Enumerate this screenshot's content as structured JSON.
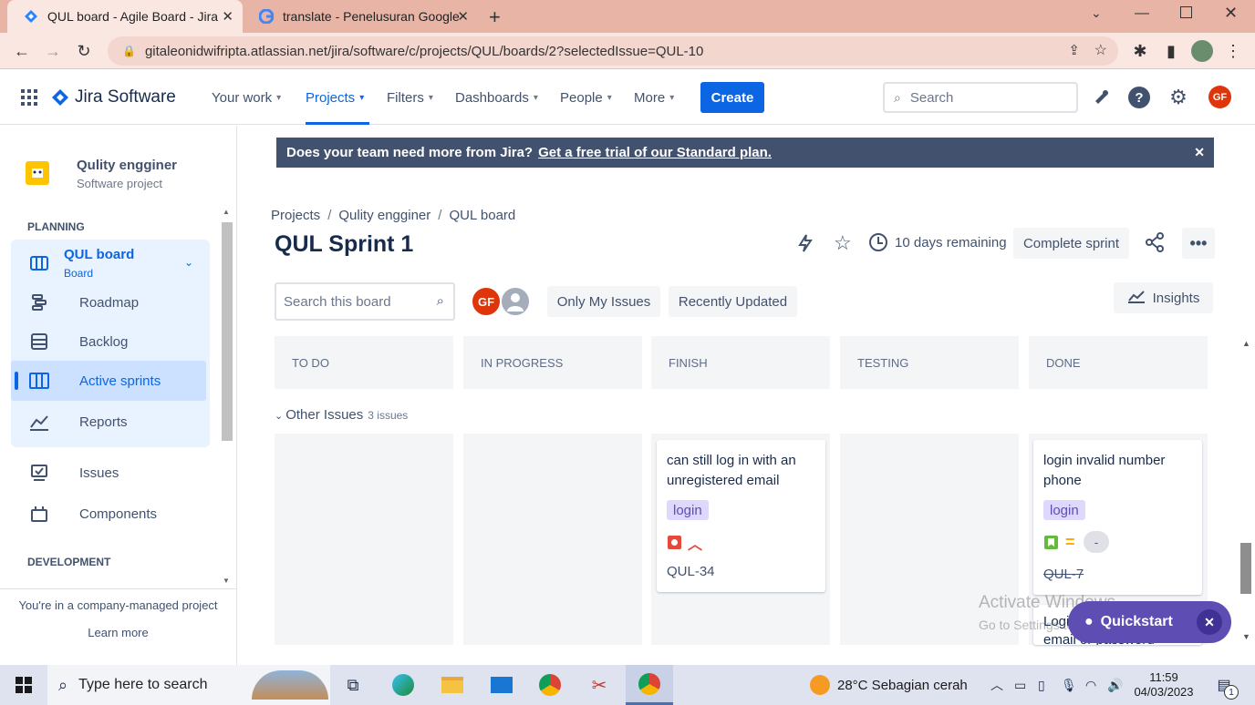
{
  "browser": {
    "tabs": [
      {
        "title": "QUL board - Agile Board - Jira",
        "active": true
      },
      {
        "title": "translate - Penelusuran Google",
        "active": false
      }
    ],
    "url": "gitaleonidwifripta.atlassian.net/jira/software/c/projects/QUL/boards/2?selectedIssue=QUL-10"
  },
  "header": {
    "product": "Jira Software",
    "nav": [
      "Your work",
      "Projects",
      "Filters",
      "Dashboards",
      "People",
      "More"
    ],
    "create_label": "Create",
    "search_placeholder": "Search",
    "avatar_initials": "GF",
    "brand_color": "#0c66e4"
  },
  "sidebar": {
    "project_name": "Qulity engginer",
    "project_type": "Software project",
    "planning_label": "PLANNING",
    "board_name": "QUL board",
    "board_sub": "Board",
    "items": [
      {
        "label": "Roadmap",
        "icon": "roadmap-icon"
      },
      {
        "label": "Backlog",
        "icon": "backlog-icon"
      },
      {
        "label": "Active sprints",
        "icon": "board-icon"
      },
      {
        "label": "Reports",
        "icon": "reports-icon"
      },
      {
        "label": "Issues",
        "icon": "issues-icon"
      },
      {
        "label": "Components",
        "icon": "components-icon"
      }
    ],
    "development_label": "DEVELOPMENT",
    "footer_text": "You're in a company-managed project",
    "learn_more": "Learn more"
  },
  "banner": {
    "text": "Does your team need more from Jira?",
    "link": "Get a free trial of our Standard plan."
  },
  "board": {
    "breadcrumbs": [
      "Projects",
      "Qulity engginer",
      "QUL board"
    ],
    "sprint_title": "QUL Sprint 1",
    "remaining": "10 days remaining",
    "complete_sprint": "Complete sprint",
    "search_placeholder": "Search this board",
    "avatar_initials": "GF",
    "only_my_issues": "Only My Issues",
    "recently_updated": "Recently Updated",
    "insights": "Insights",
    "columns": [
      "TO DO",
      "IN PROGRESS",
      "FINISH",
      "TESTING",
      "DONE"
    ],
    "swimlane": "Other Issues",
    "swimlane_count": "3 issues",
    "cards": [
      {
        "title": "can still log in with an unregistered email",
        "label": "login",
        "key": "QUL-34"
      },
      {
        "title": "login invalid number phone",
        "label": "login",
        "key": "QUL-7",
        "estimate": "-"
      },
      {
        "title": "Login ... email or password"
      }
    ],
    "partial_card_title_1": "Login",
    "partial_card_title_2": "email or password",
    "quickstart": "Quickstart"
  },
  "watermark": {
    "line1": "Activate Windows",
    "line2": "Go to Settings to activate Windows."
  },
  "taskbar": {
    "search_placeholder": "Type here to search",
    "weather": "28°C  Sebagian cerah",
    "time": "11:59",
    "date": "04/03/2023",
    "notifications": "1"
  }
}
